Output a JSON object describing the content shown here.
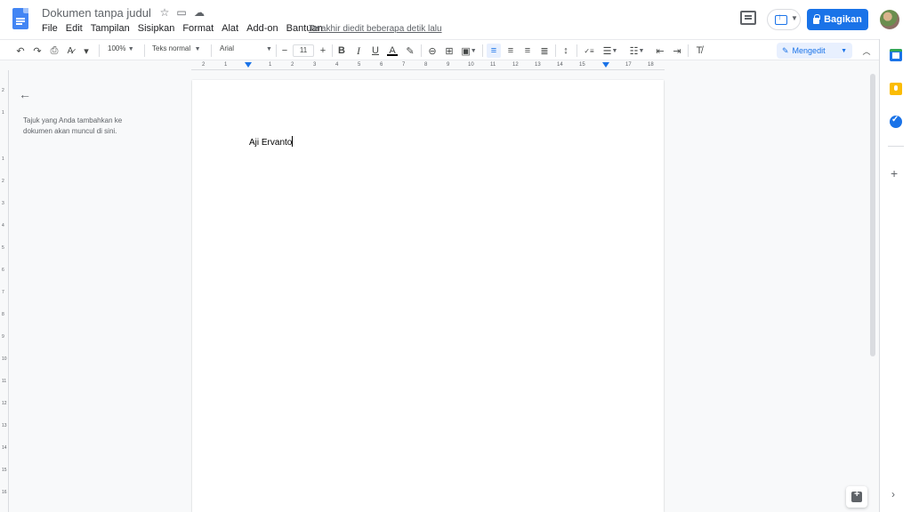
{
  "header": {
    "doc_title": "Dokumen tanpa judul",
    "last_edit": "Terakhir diedit beberapa detik lalu",
    "share_label": "Bagikan"
  },
  "menu": [
    "File",
    "Edit",
    "Tampilan",
    "Sisipkan",
    "Format",
    "Alat",
    "Add-on",
    "Bantuan"
  ],
  "toolbar": {
    "zoom": "100%",
    "style": "Teks normal",
    "font": "Arial",
    "font_size": "11",
    "mode": "Mengedit"
  },
  "ruler": {
    "numbers": [
      "2",
      "1",
      "1",
      "2",
      "3",
      "4",
      "5",
      "6",
      "7",
      "8",
      "9",
      "10",
      "11",
      "12",
      "13",
      "14",
      "15",
      "16",
      "17",
      "18"
    ],
    "vertical_numbers": [
      "2",
      "1",
      "1",
      "2",
      "3",
      "4",
      "5",
      "6",
      "7",
      "8",
      "9",
      "10",
      "11",
      "12",
      "13",
      "14",
      "15",
      "16"
    ]
  },
  "outline": {
    "hint": "Tajuk yang Anda tambahkan ke dokumen akan muncul di sini."
  },
  "document": {
    "text": "Aji Ervanto"
  },
  "colors": {
    "accent": "#1a73e8",
    "keep": "#fbbc04",
    "page_bg": "#f8f9fa"
  },
  "icons": [
    "docs-logo-icon",
    "star-icon",
    "move-folder-icon",
    "cloud-saved-icon",
    "comment-history-icon",
    "present-icon",
    "lock-icon",
    "undo-icon",
    "redo-icon",
    "print-icon",
    "spellcheck-icon",
    "paint-format-icon",
    "bold-icon",
    "italic-icon",
    "underline-icon",
    "text-color-icon",
    "highlight-icon",
    "link-icon",
    "comment-icon",
    "image-icon",
    "align-left-icon",
    "align-center-icon",
    "align-right-icon",
    "justify-icon",
    "line-spacing-icon",
    "checklist-icon",
    "bulleted-list-icon",
    "numbered-list-icon",
    "decrease-indent-icon",
    "increase-indent-icon",
    "clear-format-icon",
    "pencil-icon",
    "collapse-icon",
    "back-arrow-icon",
    "calendar-icon",
    "keep-icon",
    "tasks-icon",
    "add-icon",
    "chevron-right-icon",
    "explore-icon"
  ]
}
